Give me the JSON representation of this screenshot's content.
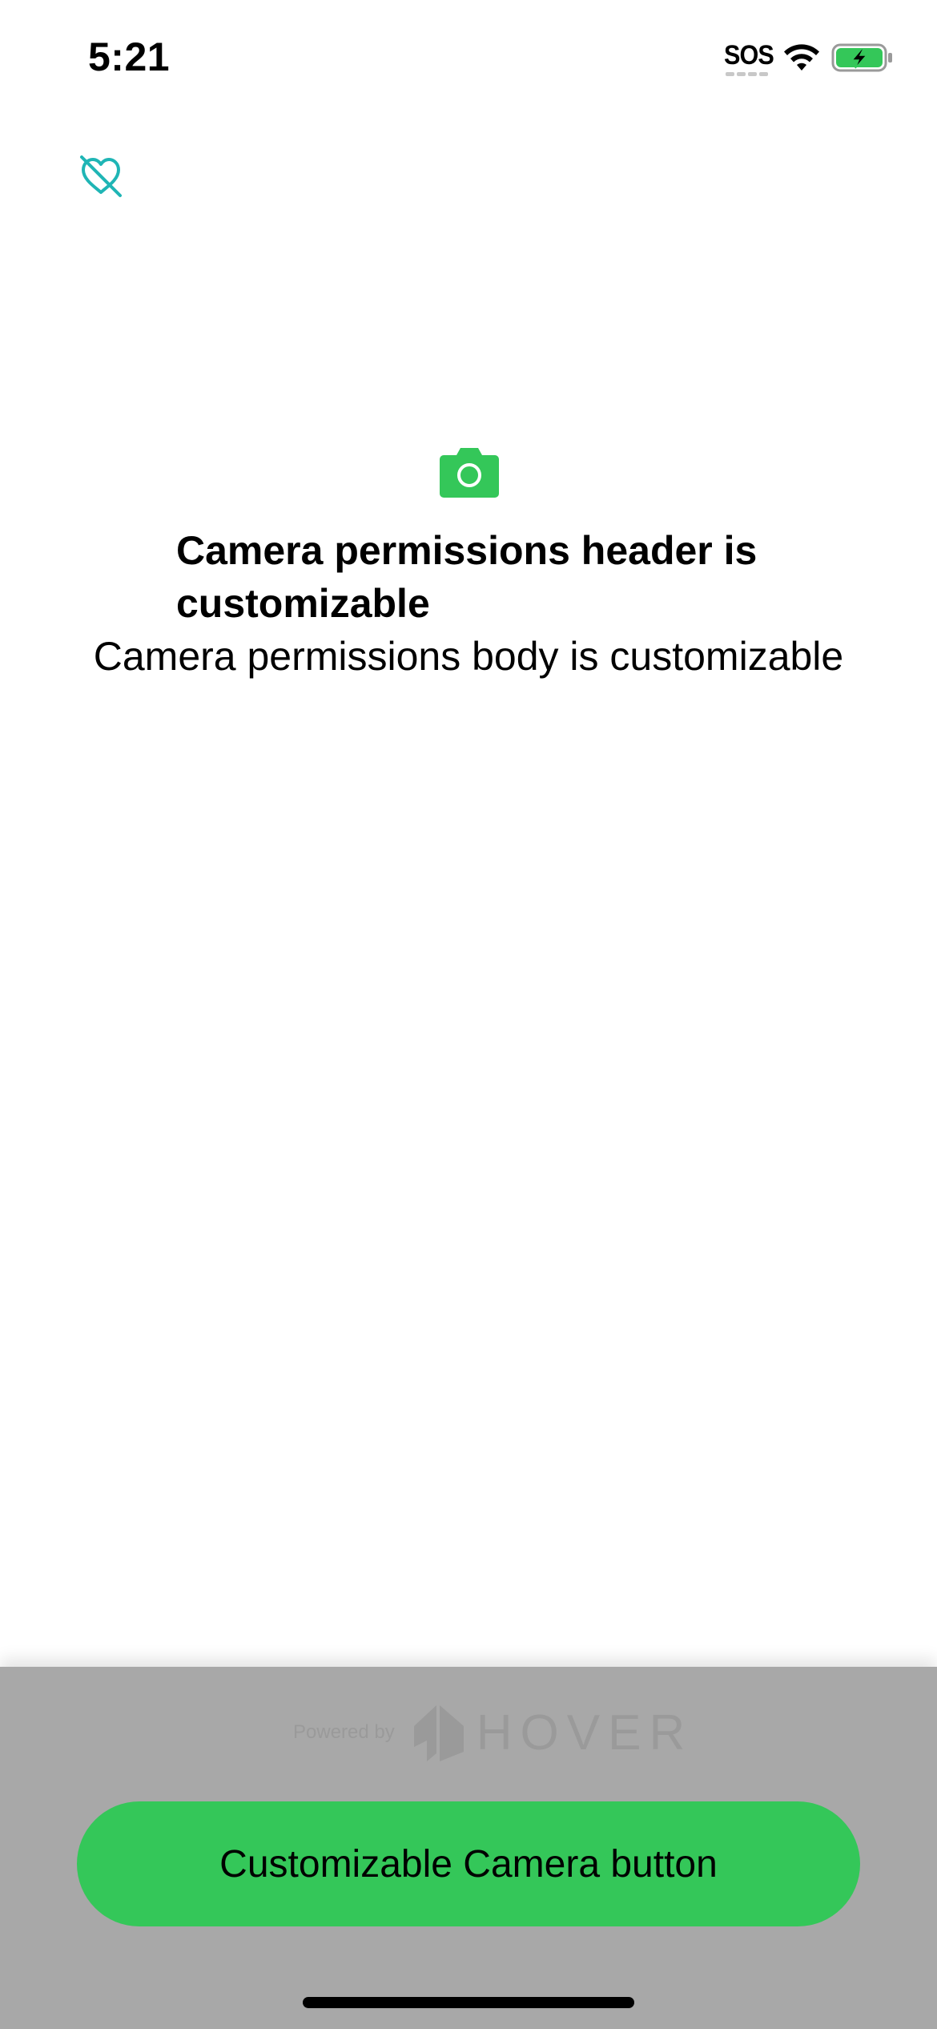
{
  "status_bar": {
    "time": "5:21",
    "sos": "SOS",
    "icons": [
      "wifi-icon",
      "battery-charging-icon"
    ],
    "battery_color": "#34c759"
  },
  "top_icon": {
    "icon": "heart-slash-icon",
    "color": "#1fb5b5"
  },
  "permissions": {
    "icon": "camera-icon",
    "icon_color": "#34c759",
    "header": "Camera permissions header is customizable",
    "body": "Camera permissions body is customizable"
  },
  "footer": {
    "powered_by": "Powered by",
    "brand": "HOVER",
    "brand_icon": "hover-house-logo-icon",
    "button_label": "Customizable Camera button",
    "button_color": "#34c759",
    "sheet_color": "#a8a8a8"
  }
}
